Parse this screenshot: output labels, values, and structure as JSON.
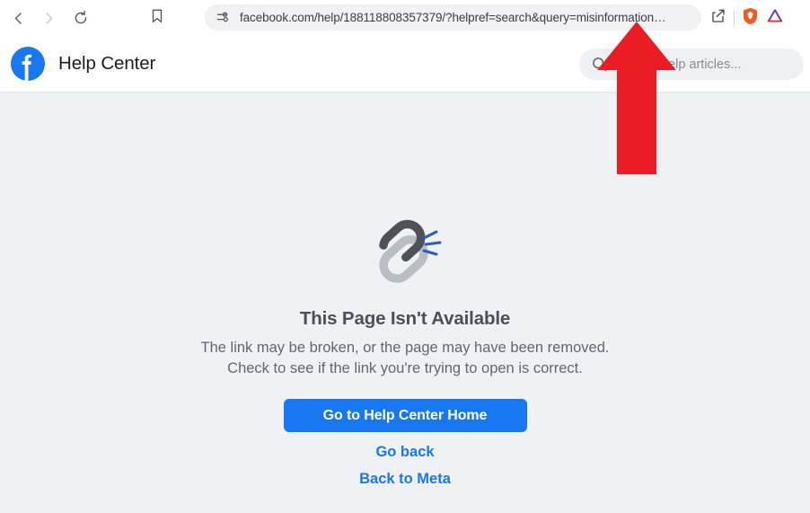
{
  "browser": {
    "back_icon": "chevron-left-icon",
    "forward_icon": "chevron-right-icon",
    "reload_icon": "reload-icon",
    "bookmark_icon": "bookmark-icon",
    "address_bar": {
      "permissions_icon": "site-permissions-icon",
      "url": "facebook.com/help/188118808357379/?helpref=search&query=misinformation…"
    },
    "share_icon": "share-icon",
    "brave_shield_icon": "brave-shield-icon",
    "extension_icon": "triangle-extension-icon"
  },
  "site_header": {
    "logo_icon": "facebook-logo-icon",
    "title": "Help Center",
    "search": {
      "icon": "search-icon",
      "placeholder": "Search help articles..."
    }
  },
  "error_page": {
    "illustration_icon": "broken-link-icon",
    "title": "This Page Isn't Available",
    "line1": "The link may be broken, or the page may have been removed.",
    "line2": "Check to see if the link you're trying to open is correct.",
    "primary_button": "Go to Help Center Home",
    "link_go_back": "Go back",
    "link_back_to_meta": "Back to Meta"
  },
  "annotation": {
    "arrow_icon": "red-up-arrow-annotation",
    "color": "#ec1c24"
  },
  "colors": {
    "facebook_blue": "#1877f2",
    "page_background": "#eff1f5",
    "header_background": "#ffffff",
    "title_text": "#4b4f56",
    "body_text": "#606770",
    "annotation_red": "#ec1c24"
  }
}
